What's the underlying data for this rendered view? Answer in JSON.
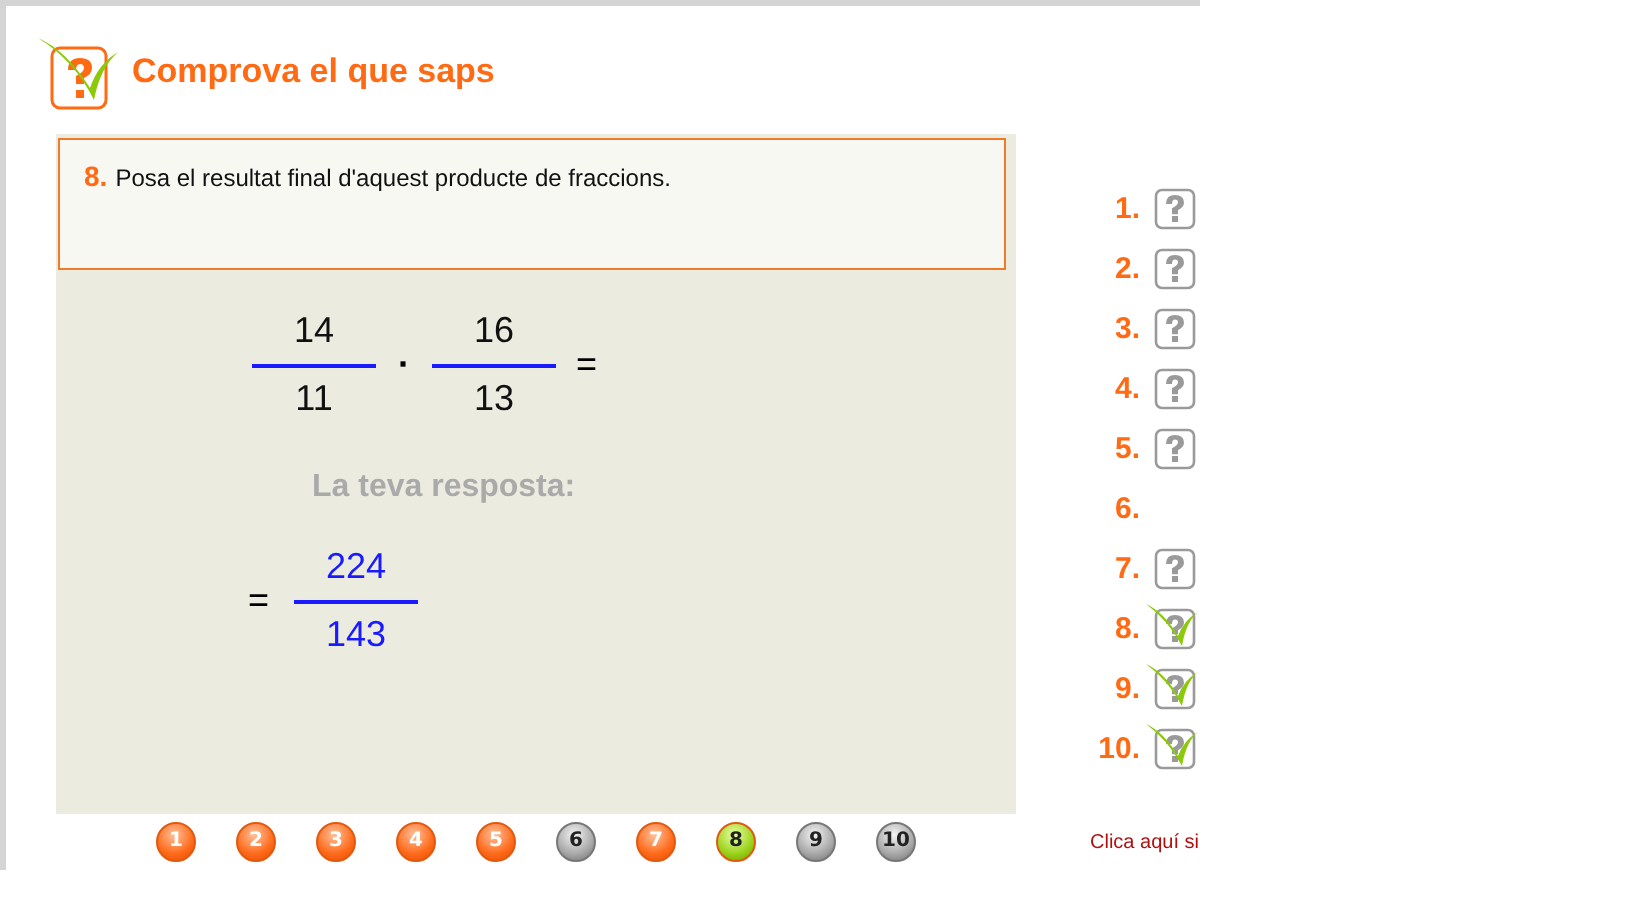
{
  "header": {
    "title": "Comprova el que saps"
  },
  "question": {
    "number": "8.",
    "text": "Posa el resultat final d'aquest producte de fraccions."
  },
  "expression": {
    "fractions": [
      {
        "numerator": "14",
        "denominator": "11"
      },
      {
        "numerator": "16",
        "denominator": "13"
      }
    ],
    "operator": "·",
    "equals": "="
  },
  "answer": {
    "label": "La teva resposta:",
    "equals": "=",
    "numerator": "224",
    "denominator": "143"
  },
  "question_list": [
    {
      "number": "1.",
      "kind": "pending"
    },
    {
      "number": "2.",
      "kind": "pending"
    },
    {
      "number": "3.",
      "kind": "pending"
    },
    {
      "number": "4.",
      "kind": "pending"
    },
    {
      "number": "5.",
      "kind": "pending"
    },
    {
      "number": "6.",
      "kind": "empty"
    },
    {
      "number": "7.",
      "kind": "pending"
    },
    {
      "number": "8.",
      "kind": "checked"
    },
    {
      "number": "9.",
      "kind": "checked"
    },
    {
      "number": "10.",
      "kind": "checked"
    }
  ],
  "pager": [
    {
      "label": "1",
      "kind": "answered",
      "selected": false
    },
    {
      "label": "2",
      "kind": "answered",
      "selected": false
    },
    {
      "label": "3",
      "kind": "answered",
      "selected": false
    },
    {
      "label": "4",
      "kind": "answered",
      "selected": false
    },
    {
      "label": "5",
      "kind": "answered",
      "selected": false
    },
    {
      "label": "6",
      "kind": "unanswered",
      "selected": false
    },
    {
      "label": "7",
      "kind": "answered",
      "selected": false
    },
    {
      "label": "8",
      "kind": "answered",
      "selected": true
    },
    {
      "label": "9",
      "kind": "unanswered",
      "selected": false
    },
    {
      "label": "10",
      "kind": "unanswered",
      "selected": false
    }
  ],
  "footer_link": "Clica aquí si"
}
